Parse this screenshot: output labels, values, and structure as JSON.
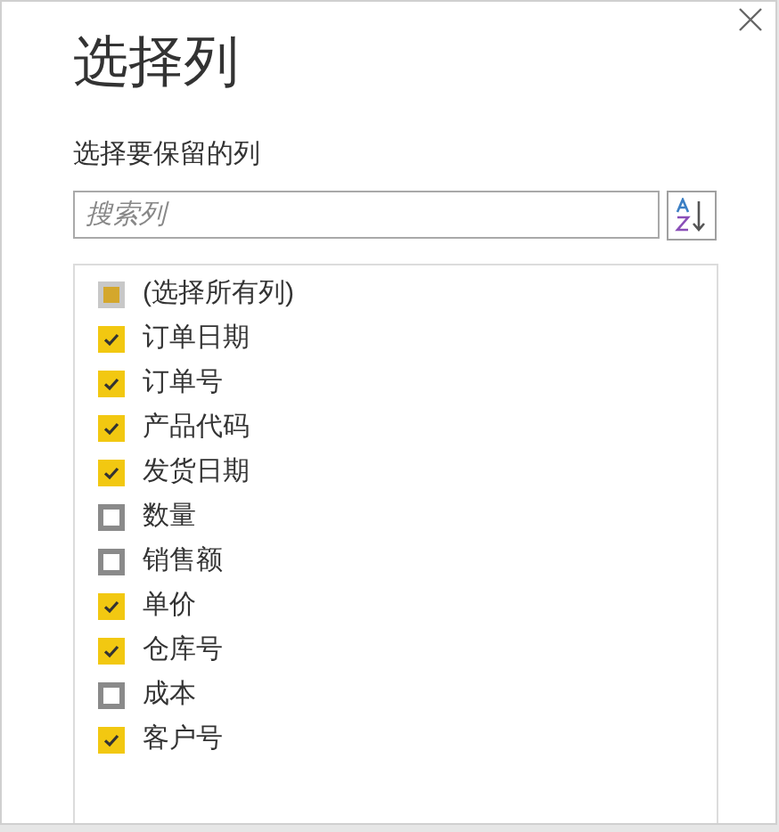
{
  "dialog": {
    "title": "选择列",
    "subtitle": "选择要保留的列"
  },
  "search": {
    "placeholder": "搜索列"
  },
  "select_all": {
    "label": "(选择所有列)",
    "indeterminate": true
  },
  "columns": [
    {
      "label": "订单日期",
      "checked": true
    },
    {
      "label": "订单号",
      "checked": true
    },
    {
      "label": "产品代码",
      "checked": true
    },
    {
      "label": "发货日期",
      "checked": true
    },
    {
      "label": "数量",
      "checked": false
    },
    {
      "label": "销售额",
      "checked": false
    },
    {
      "label": "单价",
      "checked": true
    },
    {
      "label": "仓库号",
      "checked": true
    },
    {
      "label": "成本",
      "checked": false
    },
    {
      "label": "客户号",
      "checked": true
    }
  ]
}
